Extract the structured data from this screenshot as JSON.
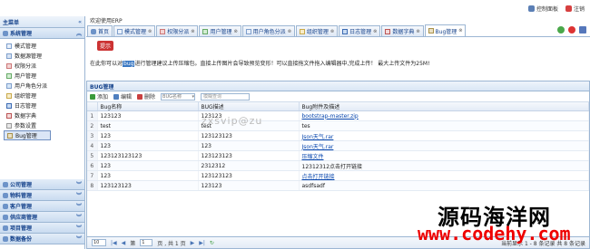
{
  "topbar": {
    "control_panel": "控制面板",
    "logout": "注销"
  },
  "sidebar": {
    "title": "主菜单",
    "active_section": "系统管理",
    "items": [
      {
        "label": "模式管理"
      },
      {
        "label": "数据源管理"
      },
      {
        "label": "权限分派"
      },
      {
        "label": "用户管理"
      },
      {
        "label": "用户角色分派"
      },
      {
        "label": "组织管理"
      },
      {
        "label": "日志管理"
      },
      {
        "label": "数据字典"
      },
      {
        "label": "参数设置"
      },
      {
        "label": "Bug管理"
      }
    ],
    "sections": [
      {
        "label": "公司管理"
      },
      {
        "label": "物料管理"
      },
      {
        "label": "客户管理"
      },
      {
        "label": "供应商管理"
      },
      {
        "label": "项目管理"
      },
      {
        "label": "数据备份"
      }
    ]
  },
  "main": {
    "title": "欢迎使用ERP",
    "tabs": [
      {
        "label": "首页"
      },
      {
        "label": "模式管理"
      },
      {
        "label": "权限分派"
      },
      {
        "label": "用户管理"
      },
      {
        "label": "用户角色分派"
      },
      {
        "label": "组织管理"
      },
      {
        "label": "日志管理"
      },
      {
        "label": "数据字典"
      },
      {
        "label": "Bug管理"
      }
    ],
    "tip_badge": "提示",
    "notice_pre": "在此你可以对",
    "notice_hl": "bug",
    "notice_post": "进行管理建议上传压缩包。直接上传图片会导致预览变形！可以直接拖文件拖入编辑器中,完成上传！ 最大上传文件为25M!"
  },
  "panel": {
    "title": "BUG管理",
    "toolbar": {
      "add": "添加",
      "edit": "编辑",
      "delete": "删除",
      "select": "BUG名称",
      "search_placeholder": "模糊查询"
    },
    "columns": [
      "Bug名称",
      "BUG描述",
      "Bug附件及描述"
    ],
    "rows": [
      {
        "n": "1",
        "name": "123123",
        "desc": "123123",
        "att": "bootstrap-master.zip",
        "link": true
      },
      {
        "n": "2",
        "name": "test",
        "desc": "test",
        "att": "tes",
        "link": false
      },
      {
        "n": "3",
        "name": "123",
        "desc": "123123123",
        "att": "Json天气.rar",
        "link": true
      },
      {
        "n": "4",
        "name": "123",
        "desc": "123",
        "att": "Json天气.rar",
        "link": true
      },
      {
        "n": "5",
        "name": "123123123123",
        "desc": "123123123",
        "att": "压缩文件",
        "link": true
      },
      {
        "n": "6",
        "name": "123",
        "desc": "2312312",
        "att": "12312312点击打开链接",
        "link": false
      },
      {
        "n": "7",
        "name": "123",
        "desc": "123123123",
        "att": "点击打开链接",
        "link": true
      },
      {
        "n": "8",
        "name": "123123123",
        "desc": "123123",
        "att": "asdfsadf",
        "link": false
      }
    ],
    "pager": {
      "size": "10",
      "page_label": "第",
      "page_value": "1",
      "total": "页 , 共 1 页",
      "info": "当前显示 1 - 8 条记录 共 8 条记录"
    }
  },
  "watermarks": {
    "site": "zxsvip@zu",
    "brand_cn": "源码海洋网",
    "brand_url": "www.codehy.com"
  }
}
